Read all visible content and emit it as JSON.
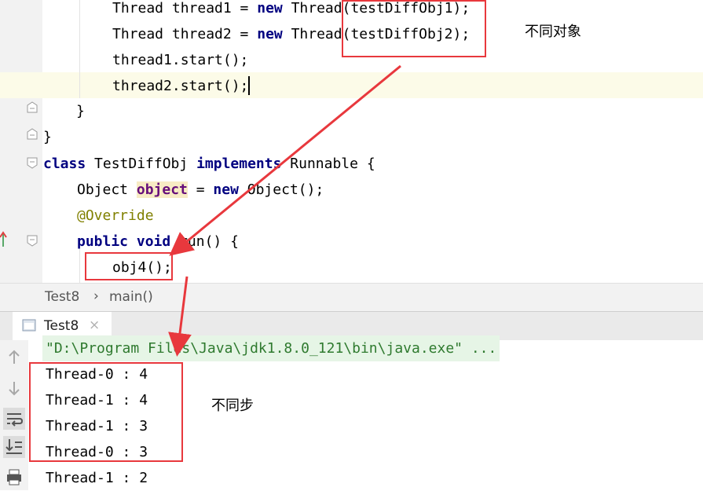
{
  "editor": {
    "lines": [
      {
        "segments": [
          {
            "t": "Thread thread1 = "
          },
          {
            "t": "new",
            "c": "kw"
          },
          {
            "t": " Thread(testDiffObj1);"
          }
        ]
      },
      {
        "segments": [
          {
            "t": "Thread thread2 = "
          },
          {
            "t": "new",
            "c": "kw"
          },
          {
            "t": " Thread(testDiffObj2);"
          }
        ]
      },
      {
        "segments": [
          {
            "t": "thread1.start();"
          }
        ]
      },
      {
        "segments": [
          {
            "t": "thread2.start();"
          }
        ]
      },
      {
        "segments": [
          {
            "t": "}"
          }
        ]
      },
      {
        "segments": [
          {
            "t": "}"
          }
        ]
      },
      {
        "segments": [
          {
            "t": "class",
            "c": "kw"
          },
          {
            "t": " TestDiffObj "
          },
          {
            "t": "implements",
            "c": "kw"
          },
          {
            "t": " Runnable {"
          }
        ]
      },
      {
        "segments": [
          {
            "t": "Object "
          },
          {
            "t": "object",
            "c": "fld hl"
          },
          {
            "t": " = "
          },
          {
            "t": "new",
            "c": "kw"
          },
          {
            "t": " Object();"
          }
        ]
      },
      {
        "segments": [
          {
            "t": "@Override",
            "c": "ann"
          }
        ]
      },
      {
        "segments": [
          {
            "t": "public",
            "c": "kw"
          },
          {
            "t": " "
          },
          {
            "t": "void",
            "c": "kw"
          },
          {
            "t": " run() {"
          }
        ]
      },
      {
        "segments": [
          {
            "t": "obj4();"
          }
        ]
      }
    ]
  },
  "breadcrumb": {
    "file": "Test8",
    "sep": "›",
    "method": "main()"
  },
  "run_tab": {
    "label": "Test8",
    "close": "×"
  },
  "console": {
    "command": "\"D:\\Program Files\\Java\\jdk1.8.0_121\\bin\\java.exe\" ...",
    "output": [
      "Thread-0 : 4",
      "Thread-1 : 4",
      "Thread-1 : 3",
      "Thread-0 : 3",
      "Thread-1 : 2"
    ]
  },
  "annotations": {
    "different_objects": "不同对象",
    "not_synchronized": "不同步"
  },
  "colors": {
    "highlight_red": "#e8383d",
    "keyword": "#000080",
    "field": "#660e7a",
    "annotation": "#808000"
  },
  "icons": [
    "fold-marker-icon",
    "run-gutter-icon",
    "arrow-up-icon",
    "arrow-down-icon",
    "soft-wrap-icon",
    "scroll-to-end-icon",
    "print-icon",
    "console-tab-icon",
    "close-icon"
  ]
}
